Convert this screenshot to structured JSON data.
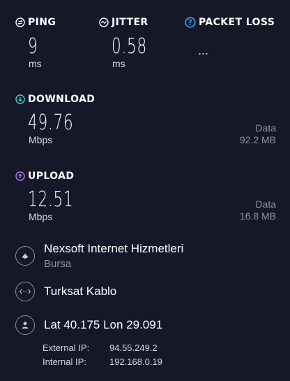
{
  "ping": {
    "label": "PING",
    "value": "9",
    "unit": "ms",
    "icon": "ping-icon"
  },
  "jitter": {
    "label": "JITTER",
    "value": "0.58",
    "unit": "ms",
    "icon": "jitter-icon"
  },
  "packet_loss": {
    "label": "PACKET LOSS",
    "value": "...",
    "icon": "help-icon"
  },
  "download": {
    "label": "DOWNLOAD",
    "value": "49.76",
    "unit": "Mbps",
    "data_label": "Data",
    "data_value": "92.2 MB",
    "icon": "download-icon",
    "icon_color": "#4fd1c5"
  },
  "upload": {
    "label": "UPLOAD",
    "value": "12.51",
    "unit": "Mbps",
    "data_label": "Data",
    "data_value": "16.8 MB",
    "icon": "upload-icon",
    "icon_color": "#b57bf2"
  },
  "provider": {
    "name": "Nexsoft Internet Hizmetleri",
    "city": "Bursa",
    "icon": "server-icon"
  },
  "connection": {
    "name": "Turksat Kablo",
    "icon": "connection-icon"
  },
  "location": {
    "coords": "Lat 40.175 Lon 29.091",
    "icon": "person-icon",
    "external_ip_label": "External IP:",
    "external_ip": "94.55.249.2",
    "internal_ip_label": "Internal IP:",
    "internal_ip": "192.168.0.19"
  },
  "colors": {
    "background": "#151829",
    "muted": "#8e92a3",
    "help": "#3aa1f5"
  }
}
